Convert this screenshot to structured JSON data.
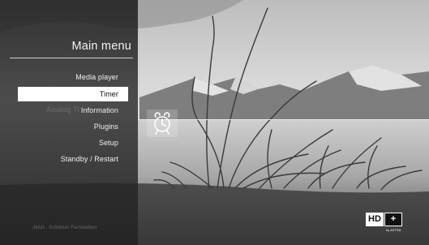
{
  "menu": {
    "title": "Main menu",
    "items": [
      {
        "label": "Media player",
        "selected": false
      },
      {
        "label": "Timer",
        "selected": true
      },
      {
        "label": "Information",
        "selected": false
      },
      {
        "label": "Plugins",
        "selected": false
      },
      {
        "label": "Setup",
        "selected": false
      },
      {
        "label": "Standby / Restart",
        "selected": false
      }
    ],
    "ghost_text": "Analog Ti",
    "footer_slogan": "Jetzt . Schöner Fernsehen"
  },
  "preview": {
    "icon": "alarm-clock-icon"
  },
  "branding": {
    "hd_label": "HD",
    "plus_label": "+",
    "by_label": "by ASTRA"
  },
  "colors": {
    "panel": "#222222",
    "selected_bg": "#ffffff",
    "selected_text": "#111111",
    "menu_text": "#f0f0f0"
  }
}
